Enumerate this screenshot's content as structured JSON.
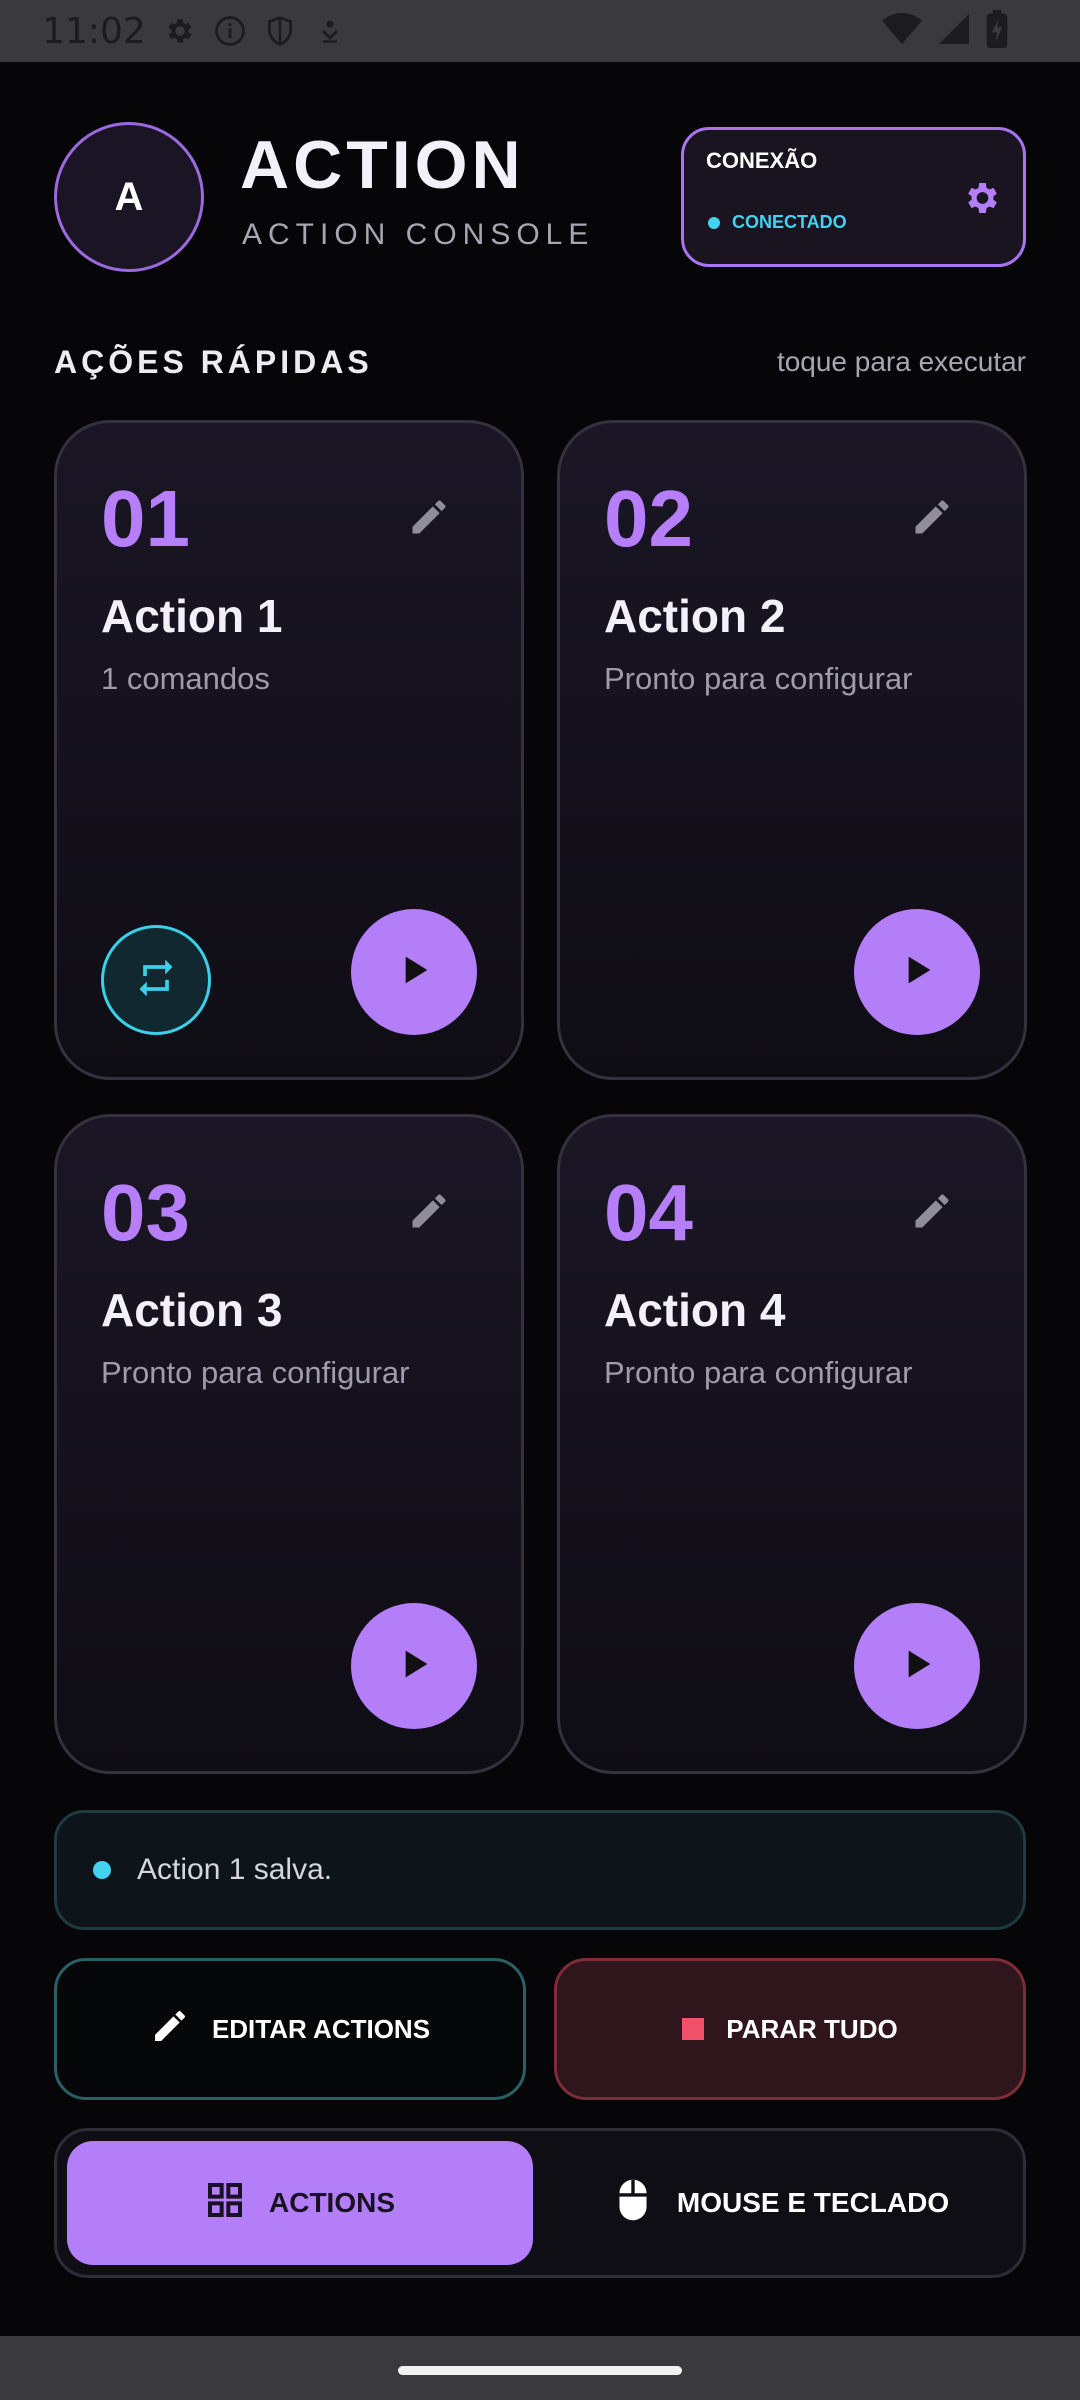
{
  "status_bar": {
    "time": "11:02"
  },
  "header": {
    "avatar_letter": "A",
    "title": "ACTION",
    "subtitle": "ACTION CONSOLE"
  },
  "connection": {
    "label": "CONEXÃO",
    "status": "CONECTADO",
    "status_color": "#41d3f0"
  },
  "section": {
    "title": "AÇÕES RÁPIDAS",
    "hint": "toque para executar"
  },
  "cards": [
    {
      "number": "01",
      "name": "Action 1",
      "desc": "1 comandos",
      "loop": true
    },
    {
      "number": "02",
      "name": "Action 2",
      "desc": "Pronto para configurar",
      "loop": false
    },
    {
      "number": "03",
      "name": "Action 3",
      "desc": "Pronto para configurar",
      "loop": false
    },
    {
      "number": "04",
      "name": "Action 4",
      "desc": "Pronto para configurar",
      "loop": false
    }
  ],
  "toast": {
    "message": "Action 1 salva."
  },
  "buttons": {
    "edit_label": "EDITAR ACTIONS",
    "stop_label": "PARAR TUDO"
  },
  "tabs": [
    {
      "label": "ACTIONS",
      "icon": "grid-icon",
      "active": true
    },
    {
      "label": "MOUSE E TECLADO",
      "icon": "mouse-icon",
      "active": false
    }
  ],
  "colors": {
    "accent": "#b47ef8",
    "cyan": "#41d3f0",
    "danger": "#f0526a",
    "background": "#060608"
  }
}
